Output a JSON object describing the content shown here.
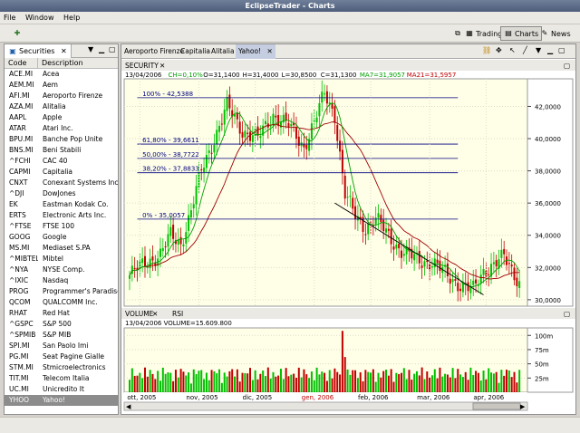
{
  "window": {
    "title": "EclipseTrader - Charts"
  },
  "menu": [
    "File",
    "Window",
    "Help"
  ],
  "perspectives": [
    {
      "label": "Trading",
      "icon": "trading-icon",
      "active": false
    },
    {
      "label": "Charts",
      "icon": "charts-icon",
      "active": true
    },
    {
      "label": "News",
      "icon": "news-icon",
      "active": false
    }
  ],
  "securities_view": {
    "tab_label": "Securities",
    "columns": [
      "Code",
      "Description"
    ],
    "rows": [
      [
        "ACE.MI",
        "Acea"
      ],
      [
        "AEM.MI",
        "Aem"
      ],
      [
        "AFI.MI",
        "Aeroporto Firenze"
      ],
      [
        "AZA.MI",
        "Alitalia"
      ],
      [
        "AAPL",
        "Apple"
      ],
      [
        "ATAR",
        "Atari Inc."
      ],
      [
        "BPU.MI",
        "Banche Pop Unite"
      ],
      [
        "BNS.MI",
        "Beni Stabili"
      ],
      [
        "^FCHI",
        "CAC 40"
      ],
      [
        "CAPMI",
        "Capitalia"
      ],
      [
        "CNXT",
        "Conexant Systems Inc."
      ],
      [
        "^DJI",
        "DowJones"
      ],
      [
        "EK",
        "Eastman Kodak Co."
      ],
      [
        "ERTS",
        "Electronic Arts Inc."
      ],
      [
        "^FTSE",
        "FTSE 100"
      ],
      [
        "GOOG",
        "Google"
      ],
      [
        "MS.MI",
        "Mediaset S.PA"
      ],
      [
        "^MIBTEL",
        "Mibtel"
      ],
      [
        "^NYA",
        "NYSE Comp."
      ],
      [
        "^IXIC",
        "Nasdaq"
      ],
      [
        "PROG",
        "Programmer's Paradise"
      ],
      [
        "QCOM",
        "QUALCOMM Inc."
      ],
      [
        "RHAT",
        "Red Hat"
      ],
      [
        "^GSPC",
        "S&P 500"
      ],
      [
        "^SPMIB",
        "S&P MIB"
      ],
      [
        "SPI.MI",
        "San Paolo Imi"
      ],
      [
        "PG.MI",
        "Seat Pagine  Gialle"
      ],
      [
        "STM.MI",
        "Stmicroelectronics"
      ],
      [
        "TIT.MI",
        "Telecom Italia"
      ],
      [
        "UC.MI",
        "Unicredito It"
      ],
      [
        "YHOO",
        "Yahoo!"
      ]
    ],
    "selected_index": 30
  },
  "chart_tabs": [
    {
      "label": "Aeroporto Firenze",
      "active": false
    },
    {
      "label": "Capitalia",
      "active": false
    },
    {
      "label": "Alitalia",
      "active": false
    },
    {
      "label": "Yahoo!",
      "active": true
    }
  ],
  "price_pane": {
    "tab_label": "SECURITY",
    "info": [
      {
        "text": "13/04/2006",
        "color": "#000000"
      },
      {
        "text": "CH=0,10%",
        "color": "#00a000"
      },
      {
        "text": "O=31,1400",
        "color": "#000000"
      },
      {
        "text": "H=31,4000",
        "color": "#000000"
      },
      {
        "text": "L=30,8500",
        "color": "#000000"
      },
      {
        "text": "C=31,1300",
        "color": "#000000"
      },
      {
        "text": "MA7=31,9057",
        "color": "#00a000"
      },
      {
        "text": "MA21=31,5957",
        "color": "#c00000"
      }
    ],
    "y_ticks": [
      "42,0000",
      "40,0000",
      "38,0000",
      "36,0000",
      "34,0000",
      "32,0000",
      "30,0000"
    ],
    "fib_levels": [
      {
        "label": "100% - 42,5388",
        "value": 42.5388
      },
      {
        "label": "61,80% - 39,6611",
        "value": 39.6611
      },
      {
        "label": "50,00% - 38,7722",
        "value": 38.7722
      },
      {
        "label": "38,20% - 37,8833",
        "value": 37.8833
      },
      {
        "label": "0% - 35,0057",
        "value": 35.0057
      }
    ]
  },
  "volume_pane": {
    "tabs": [
      "VOLUME",
      "RSI"
    ],
    "info": "13/04/2006  VOLUME=15.609.800",
    "y_ticks": [
      "100m",
      "75m",
      "50m",
      "25m"
    ]
  },
  "x_axis": [
    {
      "label": "ott, 2005",
      "color": "#000000"
    },
    {
      "label": "nov, 2005",
      "color": "#000000"
    },
    {
      "label": "dic, 2005",
      "color": "#000000"
    },
    {
      "label": "gen, 2006",
      "color": "#c00000"
    },
    {
      "label": "feb, 2006",
      "color": "#000000"
    },
    {
      "label": "mar, 2006",
      "color": "#000000"
    },
    {
      "label": "apr, 2006",
      "color": "#000000"
    }
  ],
  "colors": {
    "chart_bg": "#ffffe8",
    "up": "#00c000",
    "down": "#c00000",
    "ma7": "#00a000",
    "ma21": "#a00000",
    "fib": "#000080"
  },
  "chart_data": {
    "type": "candlestick",
    "ylim": [
      29.6,
      43.6
    ],
    "close_key_points": [
      [
        0,
        31.5
      ],
      [
        6,
        32.3
      ],
      [
        12,
        32.8
      ],
      [
        16,
        34.0
      ],
      [
        20,
        33.5
      ],
      [
        24,
        35.5
      ],
      [
        28,
        38.0
      ],
      [
        33,
        40.0
      ],
      [
        38,
        42.0
      ],
      [
        44,
        40.5
      ],
      [
        50,
        40.0
      ],
      [
        56,
        41.5
      ],
      [
        62,
        40.8
      ],
      [
        68,
        39.5
      ],
      [
        72,
        41.0
      ],
      [
        76,
        42.8
      ],
      [
        80,
        41.5
      ],
      [
        84,
        36.5
      ],
      [
        88,
        35.2
      ],
      [
        92,
        34.5
      ],
      [
        96,
        35.0
      ],
      [
        100,
        34.2
      ],
      [
        106,
        33.0
      ],
      [
        112,
        32.5
      ],
      [
        118,
        32.3
      ],
      [
        124,
        31.5
      ],
      [
        130,
        30.8
      ],
      [
        134,
        30.6
      ],
      [
        138,
        31.8
      ],
      [
        142,
        32.2
      ],
      [
        146,
        32.6
      ],
      [
        150,
        31.6
      ],
      [
        152,
        31.13
      ]
    ],
    "volume_spike_index": 83
  }
}
